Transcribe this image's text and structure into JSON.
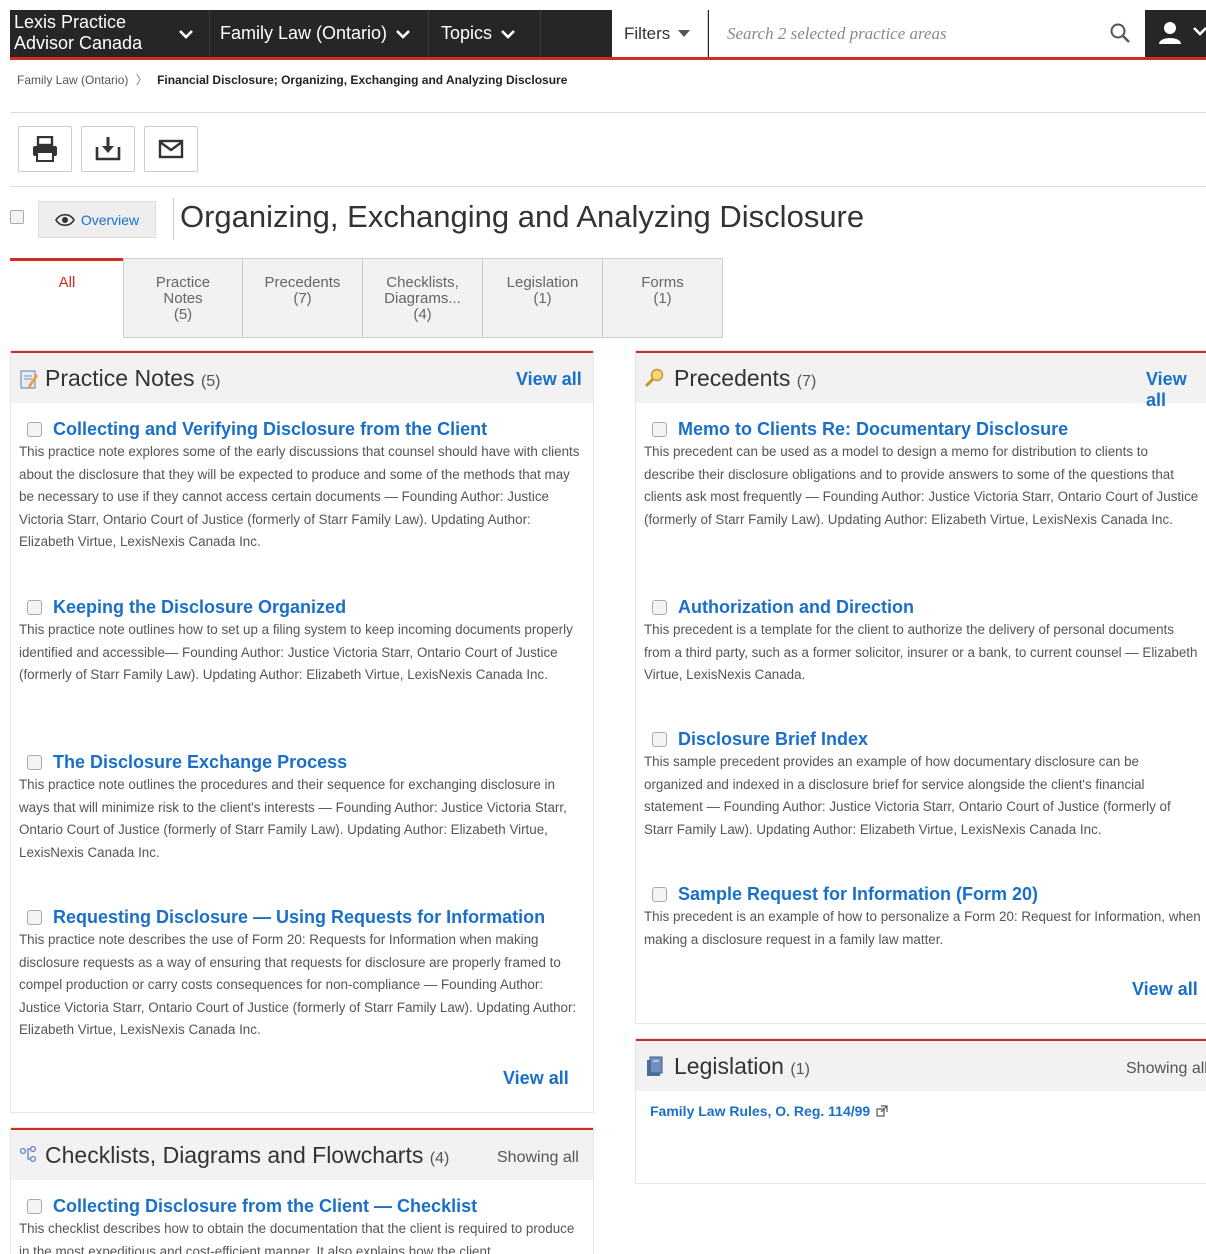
{
  "nav": {
    "brand_line1": "Lexis Practice",
    "brand_line2": "Advisor Canada",
    "practice_area": "Family Law (Ontario)",
    "topics": "Topics",
    "filters": "Filters",
    "search_placeholder": "Search 2 selected practice areas"
  },
  "breadcrumb": {
    "parent": "Family Law (Ontario)",
    "separator": "〉",
    "current": "Financial Disclosure; Organizing, Exchanging and Analyzing Disclosure"
  },
  "title": {
    "overview_label": "Overview",
    "heading": "Organizing, Exchanging and Analyzing Disclosure"
  },
  "tabs": [
    {
      "label": "All",
      "count": ""
    },
    {
      "label": "Practice Notes",
      "count": "(5)"
    },
    {
      "label": "Precedents",
      "count": "(7)"
    },
    {
      "label": "Checklists, Diagrams...",
      "count": "(4)"
    },
    {
      "label": "Legislation",
      "count": "(1)"
    },
    {
      "label": "Forms",
      "count": "(1)"
    }
  ],
  "practice_notes": {
    "title": "Practice Notes",
    "count": "(5)",
    "view_all": "View all",
    "items": [
      {
        "title": "Collecting and Verifying Disclosure from the Client",
        "desc": "This practice note explores some of the early discussions that counsel should have with clients about the disclosure that they will be expected to produce and some of the methods that may be necessary to use if they cannot access certain documents — Founding Author: Justice Victoria Starr, Ontario Court of Justice (formerly of Starr Family Law). Updating Author: Elizabeth Virtue, LexisNexis Canada Inc."
      },
      {
        "title": "Keeping the Disclosure Organized",
        "desc": "This practice note outlines how to set up a filing system to keep incoming documents properly identified and accessible— Founding Author: Justice Victoria Starr, Ontario Court of Justice (formerly of Starr Family Law). Updating Author: Elizabeth Virtue, LexisNexis Canada Inc."
      },
      {
        "title": "The Disclosure Exchange Process",
        "desc": "This practice note outlines the procedures and their sequence for exchanging disclosure in ways that will minimize risk to the client's interests — Founding Author: Justice Victoria Starr, Ontario Court of Justice (formerly of Starr Family Law). Updating Author: Elizabeth Virtue, LexisNexis Canada Inc."
      },
      {
        "title": "Requesting Disclosure — Using Requests for Information",
        "desc": "This practice note describes the use of Form 20: Requests for Information when making disclosure requests as a way of ensuring that requests for disclosure are properly framed to compel production or carry costs consequences for non-compliance — Founding Author: Justice Victoria Starr, Ontario Court of Justice (formerly of Starr Family Law). Updating Author: Elizabeth Virtue, LexisNexis Canada Inc."
      }
    ]
  },
  "precedents": {
    "title": "Precedents",
    "count": "(7)",
    "view_all": "View all",
    "items": [
      {
        "title": "Memo to Clients Re: Documentary Disclosure",
        "desc": "This precedent can be used as a model to design a memo for distribution to clients to describe their disclosure obligations and to provide answers to some of the questions that clients ask most frequently — Founding Author: Justice Victoria Starr, Ontario Court of Justice (formerly of Starr Family Law). Updating Author: Elizabeth Virtue, LexisNexis Canada Inc."
      },
      {
        "title": "Authorization and Direction",
        "desc": "This precedent is a template for the client to authorize the delivery of personal documents from a third party, such as a former solicitor, insurer or a bank, to current counsel — Elizabeth Virtue, LexisNexis Canada."
      },
      {
        "title": "Disclosure Brief Index",
        "desc": "This sample precedent provides an example of how documentary disclosure can be organized and indexed in a disclosure brief for service alongside the client's financial statement — Founding Author: Justice Victoria Starr, Ontario Court of Justice (formerly of Starr Family Law). Updating Author: Elizabeth Virtue, LexisNexis Canada Inc."
      },
      {
        "title": "Sample Request for Information (Form 20)",
        "desc": "This precedent is an example of how to personalize a Form 20: Request for Information, when making a disclosure request in a family law matter."
      }
    ]
  },
  "legislation": {
    "title": "Legislation",
    "count": "(1)",
    "showing": "Showing all",
    "link": "Family Law Rules, O. Reg. 114/99"
  },
  "checklists": {
    "title": "Checklists, Diagrams and Flowcharts",
    "count": "(4)",
    "showing": "Showing all",
    "items": [
      {
        "title": "Collecting Disclosure from the Client — Checklist",
        "desc": "This checklist describes how to obtain the documentation that the client is required to produce in the most expeditious and cost-efficient manner. It also explains how the client"
      }
    ]
  },
  "colors": {
    "accent_red": "#d52b1e",
    "link_blue": "#1a6fc9",
    "nav_dark": "#262626"
  }
}
